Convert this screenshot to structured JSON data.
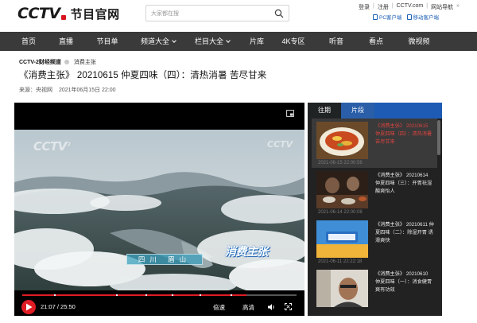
{
  "header": {
    "logo_text": "CCTV",
    "logo_sub": "节目官网",
    "search_placeholder": "大家都在搜",
    "links": [
      "登录",
      "注册",
      "CCTV.com",
      "网站导航"
    ],
    "more": "»",
    "app_links": [
      "PC客户端",
      "移动客户端"
    ]
  },
  "nav": {
    "items": [
      {
        "label": "首页",
        "dropdown": false
      },
      {
        "label": "直播",
        "dropdown": false
      },
      {
        "label": "节目单",
        "dropdown": false
      },
      {
        "label": "频道大全",
        "dropdown": true
      },
      {
        "label": "栏目大全",
        "dropdown": true
      },
      {
        "label": "片库",
        "dropdown": false
      },
      {
        "label": "4K专区",
        "dropdown": false
      },
      {
        "label": "听音",
        "dropdown": false
      },
      {
        "label": "看点",
        "dropdown": false
      },
      {
        "label": "微视频",
        "dropdown": false
      }
    ]
  },
  "breadcrumb": {
    "channel": "CCTV-2财经频道",
    "show": "消费主张"
  },
  "video": {
    "title": "《消费主张》 20210615 仲夏四味（四）：清热消暑 苦尽甘来",
    "source_label": "来源：央视网",
    "date": "2021年06月15日 22:00"
  },
  "player": {
    "watermark": "CCTV",
    "watermark_ch": "2",
    "watermark_right": "CCTV",
    "caption": "四川 眉山",
    "show_logo": "消费主张",
    "current_time": "21:07",
    "duration": "25:50",
    "time_display": "21:07 / 25:50",
    "progress": 0.818,
    "speed_label": "倍速",
    "quality_label": "高清"
  },
  "playlist": {
    "tabs": [
      "往期",
      "片段"
    ],
    "items": [
      {
        "title": "《消费主张》 20210615 仲夏四味（四）：清热消暑 苦尽甘来",
        "date": "2021-06-15 22:00:56",
        "active": true
      },
      {
        "title": "《消费主张》 20210614 仲夏四味（三）：开胃祛湿 酸爽怡人",
        "date": "2021-06-14 22:00:08",
        "active": false
      },
      {
        "title": "《消费主张》 20210611 仲夏四味（二）：除湿开胃 诱滑爽快",
        "date": "2021-06-11 22:22:18",
        "active": false
      },
      {
        "title": "《消费主张》 20210610 仲夏四味（一）：消食健胃 爽有功效",
        "date": "",
        "active": false
      }
    ]
  },
  "colors": {
    "accent": "#e01c24",
    "nav_bg": "#3a3a3a",
    "link_blue": "#1d61b6",
    "tab_blue": "#1d5bb4"
  }
}
